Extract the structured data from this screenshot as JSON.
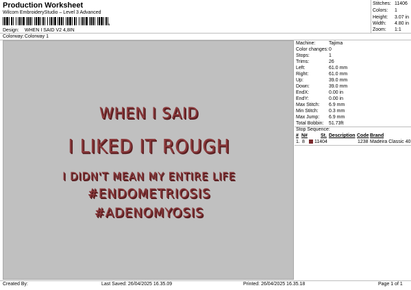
{
  "header": {
    "title": "Production Worksheet",
    "subtitle": "Wilcom EmbroideryStudio – Level 3 Advanced",
    "barcode_suffix": ",",
    "design_label": "Design:",
    "design_value": "WHEN I SAID V2 4,8IN",
    "colorway_label": "Colorway:",
    "colorway_value": "Colorway 1"
  },
  "stats": [
    {
      "label": "Stitches:",
      "value": "11406"
    },
    {
      "label": "Colors:",
      "value": "1"
    },
    {
      "label": "Height:",
      "value": "3.07 in"
    },
    {
      "label": "Width:",
      "value": "4.80 in"
    },
    {
      "label": "Zoom:",
      "value": "1:1"
    }
  ],
  "design_text": {
    "line1": "WHEN I SAID",
    "line2": "I LIKED IT ROUGH",
    "line3": "I DIDN'T MEAN MY ENTIRE LIFE",
    "line4": "#ENDOMETRIOSIS",
    "line5": "#ADENOMYOSIS",
    "thread_color": "#8c3a3c"
  },
  "machine_info": [
    {
      "label": "Machine:",
      "value": "Tajima"
    },
    {
      "label": "Color changes:",
      "value": "0"
    },
    {
      "label": "Stops:",
      "value": "1"
    },
    {
      "label": "Trims:",
      "value": "26"
    },
    {
      "label": "Left:",
      "value": "61.0 mm"
    },
    {
      "label": "Right:",
      "value": "61.0 mm"
    },
    {
      "label": "Up:",
      "value": "39.0 mm"
    },
    {
      "label": "Down:",
      "value": "39.0 mm"
    },
    {
      "label": "EndX:",
      "value": "0.00 in"
    },
    {
      "label": "EndY:",
      "value": "0.00 in"
    },
    {
      "label": "Max Stitch:",
      "value": "6.9 mm"
    },
    {
      "label": "Min Stitch:",
      "value": "0.3 mm"
    },
    {
      "label": "Max Jump:",
      "value": "6.9 mm"
    },
    {
      "label": "Total Bobbin:",
      "value": "51.73ft"
    }
  ],
  "stop_sequence": {
    "title": "Stop Sequence:",
    "columns": [
      "#",
      "N#",
      "St.",
      "Description",
      "Code",
      "Brand"
    ],
    "rows": [
      {
        "num": "1.",
        "n": "8",
        "stitches": "11404",
        "description": "",
        "code": "1238",
        "brand": "Madeira Classic 40",
        "swatch_color": "#7a2a2c"
      }
    ]
  },
  "footer": {
    "created_by": "Created By:",
    "last_saved": "Last Saved: 26/04/2025 16.35.09",
    "printed": "Printed: 26/04/2025 16.35.18",
    "page": "Page 1 of 1"
  }
}
